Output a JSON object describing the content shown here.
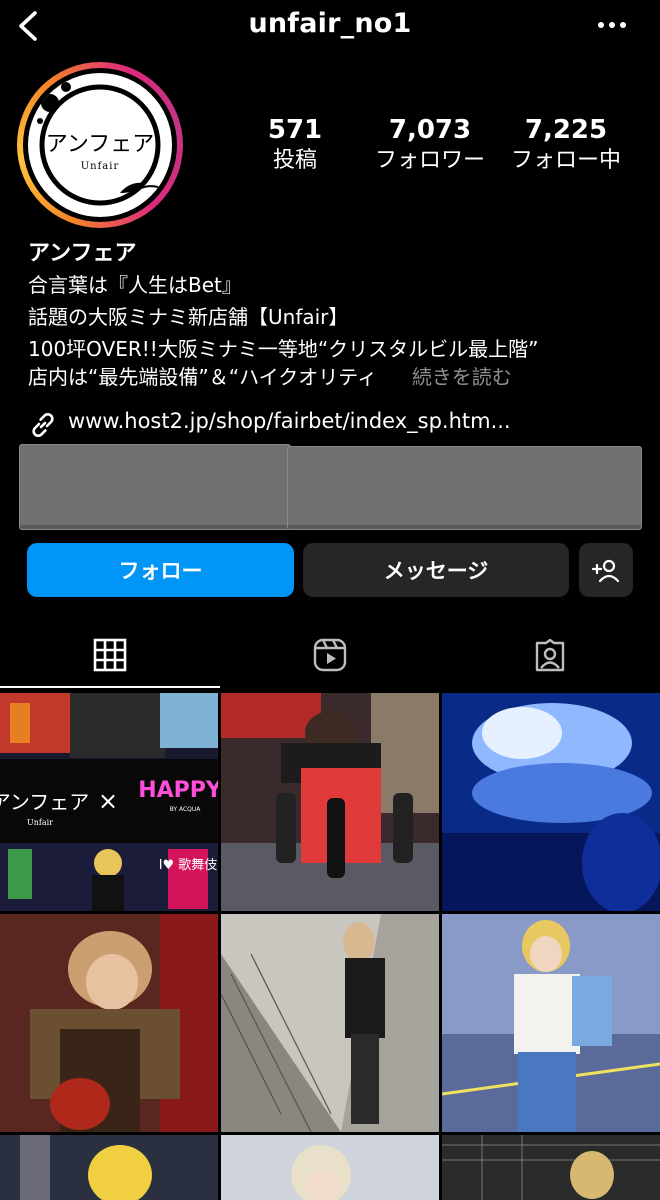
{
  "header": {
    "username": "unfair_no1",
    "back_icon": "chevron-left-icon",
    "more_icon": "more-horizontal-icon"
  },
  "profile": {
    "avatar": {
      "title_jp": "アンフェア",
      "subtitle": "Unfair"
    },
    "stats": [
      {
        "value": "571",
        "label": "投稿"
      },
      {
        "value": "7,073",
        "label": "フォロワー"
      },
      {
        "value": "7,225",
        "label": "フォロー中"
      }
    ]
  },
  "bio": {
    "name": "アンフェア",
    "lines": [
      "合言葉は『人生はBet』",
      "話題の大阪ミナミ新店舗【Unfair】",
      "100坪OVER!!大阪ミナミ一等地“クリスタルビル最上階”",
      "店内は“最先端設備”＆“ハイクオリティ"
    ],
    "more_label": "続きを読む",
    "link": "www.host2.jp/shop/fairbet/index_sp.htm..."
  },
  "actions": {
    "follow_label": "フォロー",
    "message_label": "メッセージ",
    "add_user_icon": "add-user-icon"
  },
  "tabs": [
    {
      "name": "posts",
      "icon": "grid-icon",
      "active": true
    },
    {
      "name": "reels",
      "icon": "reels-icon",
      "active": false
    },
    {
      "name": "tagged",
      "icon": "tagged-icon",
      "active": false
    }
  ],
  "posts": {
    "cell1": {
      "title_jp": "アンフェア",
      "subtitle": "Unfair",
      "cross": "×",
      "happy": "HAPPY",
      "by": "BY ACQUA",
      "sign": "I♥ 歌舞伎"
    }
  },
  "colors": {
    "follow_button": "#0095f6",
    "secondary_button": "#262626",
    "muted_text": "#8e8e8e"
  }
}
